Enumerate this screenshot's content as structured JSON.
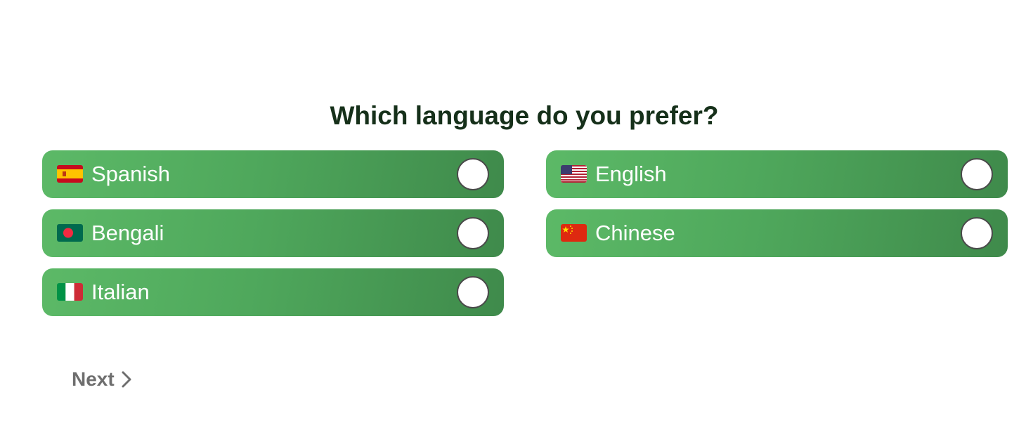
{
  "question": "Which language do you prefer?",
  "options": [
    {
      "label": "Spanish",
      "flag": "spain-flag-icon",
      "selected": false
    },
    {
      "label": "English",
      "flag": "usa-flag-icon",
      "selected": false
    },
    {
      "label": "Bengali",
      "flag": "bangladesh-flag-icon",
      "selected": false
    },
    {
      "label": "Chinese",
      "flag": "china-flag-icon",
      "selected": false
    },
    {
      "label": "Italian",
      "flag": "italy-flag-icon",
      "selected": false
    }
  ],
  "next_label": "Next",
  "next_icon": "chevron-right-icon",
  "colors": {
    "option_gradient_start": "#5cb967",
    "option_gradient_end": "#3f8a4b",
    "question_text": "#16301a",
    "next_text": "#6e6e6e"
  }
}
